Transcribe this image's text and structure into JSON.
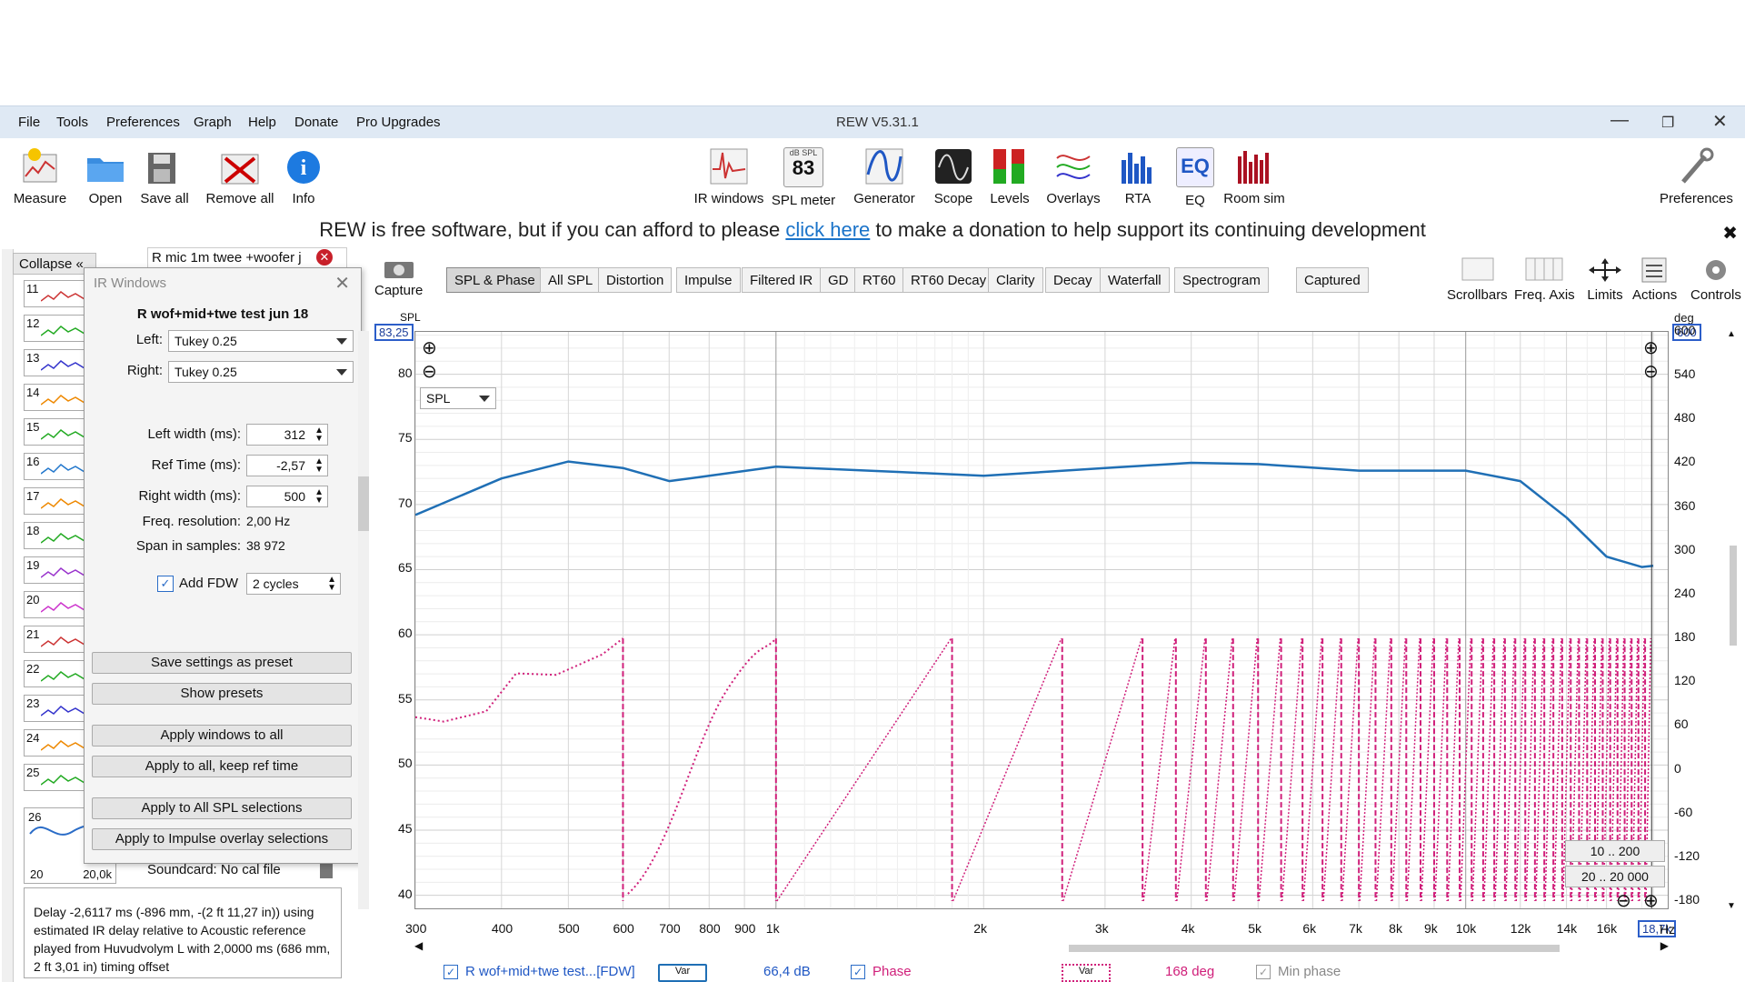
{
  "menu": {
    "file": "File",
    "tools": "Tools",
    "preferences": "Preferences",
    "graph": "Graph",
    "help": "Help",
    "donate": "Donate",
    "pro_upgrades": "Pro Upgrades"
  },
  "app_title": "REW V5.31.1",
  "toolbar": {
    "measure": "Measure",
    "open": "Open",
    "save_all": "Save all",
    "remove_all": "Remove all",
    "info": "Info",
    "ir_windows": "IR windows",
    "spl_meter": "SPL meter",
    "spl_meter_value": "83",
    "spl_meter_unit": "dB SPL",
    "generator": "Generator",
    "scope": "Scope",
    "levels": "Levels",
    "overlays": "Overlays",
    "rta": "RTA",
    "eq": "EQ",
    "eq_icon_text": "EQ",
    "room_sim": "Room sim",
    "preferences": "Preferences"
  },
  "donation": {
    "before": "REW is free software, but if you can afford to please ",
    "link": "click here",
    "after": " to make a donation to help support its continuing development"
  },
  "tabs": [
    "SPL & Phase",
    "All SPL",
    "Distortion",
    "Impulse",
    "Filtered IR",
    "GD",
    "RT60",
    "RT60 Decay",
    "Clarity",
    "Decay",
    "Waterfall",
    "Spectrogram",
    "Captured"
  ],
  "capture_label": "Capture",
  "right_tools": {
    "scrollbars": "Scrollbars",
    "freq_axis": "Freq. Axis",
    "limits": "Limits",
    "actions": "Actions",
    "controls": "Controls"
  },
  "sidebar": {
    "collapse": "Collapse",
    "measurement_name": "R mic 1m twee +woofer j",
    "thumb_numbers": [
      "11",
      "12",
      "13",
      "14",
      "15",
      "16",
      "17",
      "18",
      "19",
      "20",
      "21",
      "22",
      "23",
      "24",
      "25",
      "26"
    ],
    "last_thumb_axis_left": "20",
    "last_thumb_axis_right": "20,0k",
    "soundcard": "Soundcard: No cal file",
    "log_text": "Delay -2,6117 ms (-896 mm, -(2 ft 11,27 in)) using estimated IR delay relative to Acoustic reference played from Huvudvolym L with 2,0000 ms (686 mm, 2 ft 3,01 in) timing offset"
  },
  "ir_windows": {
    "title": "IR Windows",
    "measurement": "R wof+mid+twe test jun 18",
    "left_label": "Left:",
    "left_value": "Tukey 0.25",
    "right_label": "Right:",
    "right_value": "Tukey 0.25",
    "left_width_label": "Left width (ms):",
    "left_width": "312",
    "ref_time_label": "Ref Time (ms):",
    "ref_time": "-2,57",
    "right_width_label": "Right width (ms):",
    "right_width": "500",
    "freq_res_label": "Freq. resolution:",
    "freq_res": "2,00 Hz",
    "span_label": "Span in samples:",
    "span": "38 972",
    "add_fdw_label": "Add FDW",
    "fdw_cycles": "2 cycles",
    "buttons": [
      "Save settings as preset",
      "Show presets",
      "Apply windows to all",
      "Apply to all, keep ref time",
      "Apply to All SPL selections",
      "Apply to Impulse overlay selections"
    ]
  },
  "graph": {
    "spl_label": "SPL",
    "deg_label": "deg",
    "spl_top_badge": "83,25",
    "deg_top_badge": "600",
    "freq_end_badge": "18,7k",
    "hz_label": "Hz",
    "trace_selector": "SPL",
    "range_buttons": [
      "10 .. 200",
      "20 .. 20 000"
    ]
  },
  "chart_data": {
    "type": "line",
    "x_scale": "log",
    "x_ticks": [
      "300",
      "400",
      "500",
      "600",
      "700",
      "800",
      "900",
      "1k",
      "2k",
      "3k",
      "4k",
      "5k",
      "6k",
      "7k",
      "8k",
      "9k",
      "10k",
      "12k",
      "14k",
      "16k",
      "18,7k"
    ],
    "x_tick_values": [
      300,
      400,
      500,
      600,
      700,
      800,
      900,
      1000,
      2000,
      3000,
      4000,
      5000,
      6000,
      7000,
      8000,
      9000,
      10000,
      12000,
      14000,
      16000,
      18700
    ],
    "y_left_ticks": [
      "80",
      "75",
      "70",
      "65",
      "60",
      "55",
      "50",
      "45",
      "40"
    ],
    "y_left_range": [
      39,
      83.25
    ],
    "y_right_ticks": [
      "600",
      "540",
      "480",
      "420",
      "360",
      "300",
      "240",
      "180",
      "120",
      "60",
      "0",
      "-60",
      "-120",
      "-180"
    ],
    "y_right_range": [
      -190,
      600
    ],
    "series": [
      {
        "name": "R wof+mid+twe test...[FDW]",
        "axis": "left",
        "color": "#1f6fb5",
        "x": [
          300,
          400,
          500,
          600,
          700,
          800,
          1000,
          1500,
          2000,
          3000,
          4000,
          5000,
          7000,
          10000,
          12000,
          14000,
          16000,
          18000,
          18700
        ],
        "y": [
          69.2,
          72,
          73.3,
          72.8,
          71.8,
          72.2,
          72.9,
          72.5,
          72.2,
          72.8,
          73.2,
          73.1,
          72.6,
          72.6,
          71.8,
          69,
          66,
          65.2,
          65.3
        ]
      },
      {
        "name": "Phase",
        "axis": "right",
        "color": "#d01f7a",
        "x": [
          300,
          330,
          380,
          420,
          480,
          560,
          600
        ],
        "y": [
          72,
          66,
          80,
          132,
          130,
          158,
          180
        ]
      }
    ],
    "legend": [
      {
        "label": "R wof+mid+twe test...[FDW]",
        "value": "66,4 dB",
        "var": "Var"
      },
      {
        "label": "Phase",
        "value": "168 deg",
        "var": "Var"
      },
      {
        "label": "Min phase"
      }
    ]
  }
}
